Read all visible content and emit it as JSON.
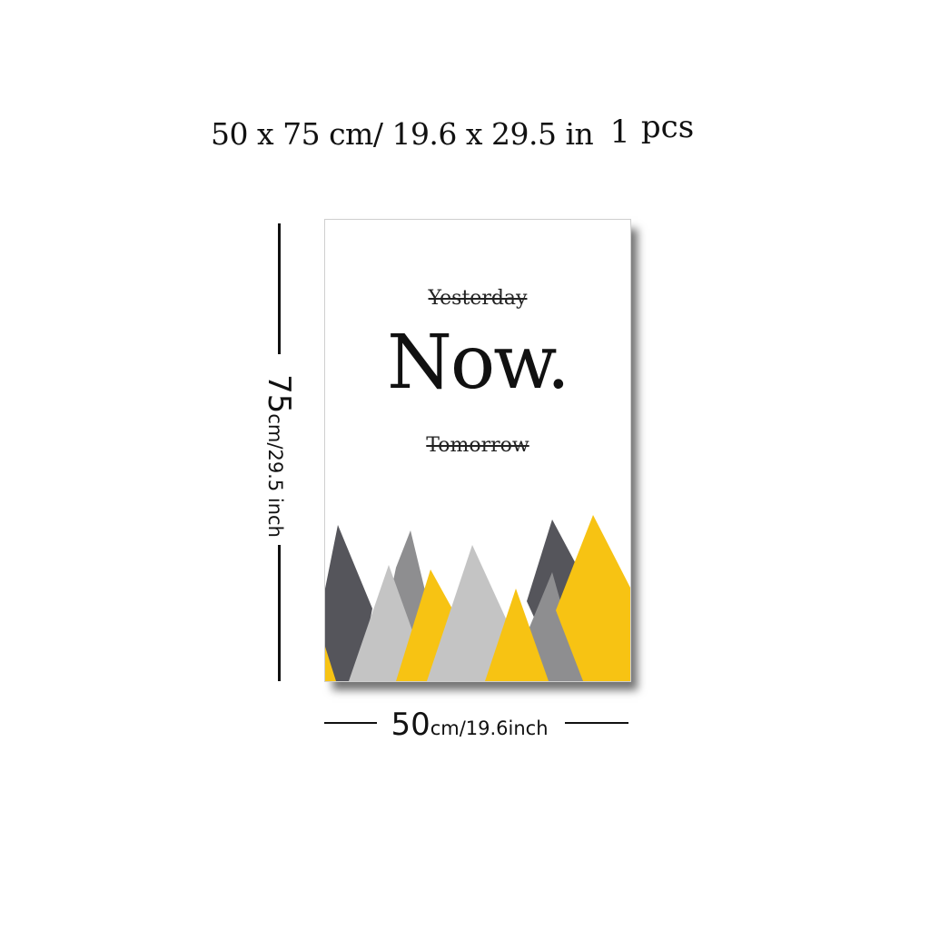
{
  "header": {
    "size_text": "50 x 75 cm/ 19.6 x 29.5 in",
    "quantity": "1",
    "quantity_unit": "pcs"
  },
  "poster": {
    "crossed_top": "Yesterday",
    "main_word": "Now.",
    "crossed_bottom": "Tomorrow",
    "colors": {
      "dark_gray": "#55555b",
      "mid_gray": "#8e8e90",
      "light_gray": "#c4c4c4",
      "yellow": "#f7c313",
      "background": "#ffffff"
    }
  },
  "dimensions": {
    "height_number": "75",
    "height_unit": "cm/29.5 inch",
    "width_number": "50",
    "width_unit": "cm/19.6inch"
  }
}
